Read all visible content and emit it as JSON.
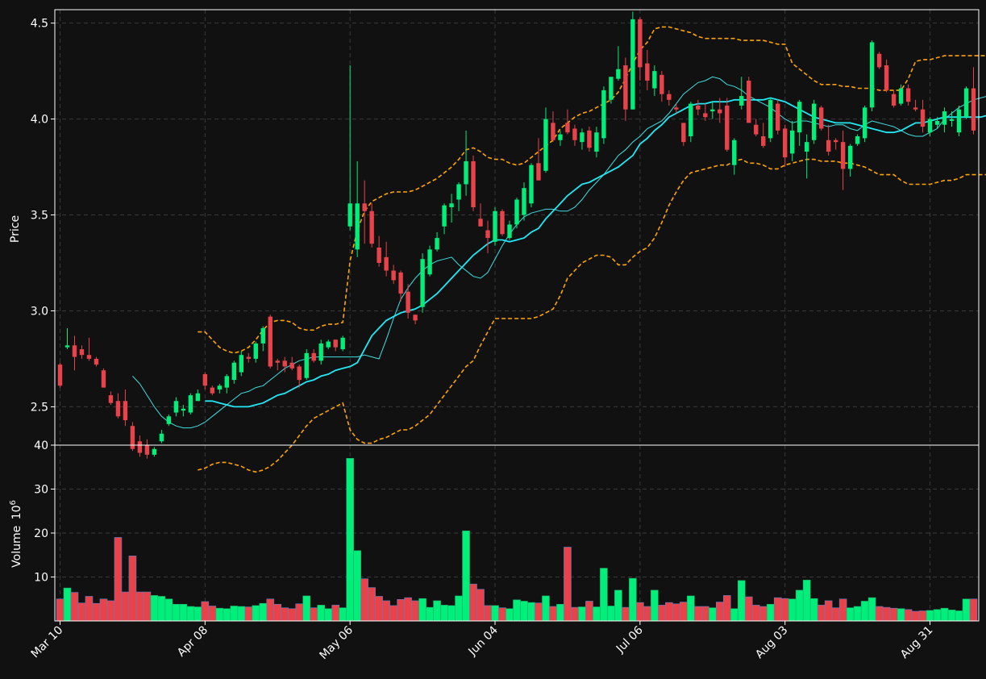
{
  "colors": {
    "background": "#111111",
    "up": "#00ee7a",
    "down": "#e8434b",
    "axis": "#ffffff",
    "grid": "#3a3a3a",
    "sma_slow": "#21e8f5",
    "sma_fast": "#3fe0e0",
    "band": "#ffa500"
  },
  "chart_data": {
    "type": "candlestick",
    "price_panel": {
      "ylabel": "Price",
      "ylim": [
        2.3,
        4.57
      ],
      "yticks": [
        "2.5",
        "3.0",
        "3.5",
        "4.0",
        "4.5"
      ],
      "grid": true
    },
    "volume_panel": {
      "ylabel": "Volume",
      "ylabel_exponent": "10",
      "ylabel_exponent_power": "6",
      "ylim": [
        0,
        40
      ],
      "yticks": [
        "10",
        "20",
        "30",
        "40"
      ],
      "grid": true
    },
    "xtick_labels": [
      "Mar 10",
      "Apr 08",
      "May 06",
      "Jun 04",
      "Jul 06",
      "Aug 03",
      "Aug 31"
    ],
    "xtick_index": [
      0,
      20,
      40,
      60,
      80,
      100,
      120
    ],
    "candles": [
      [
        2.72,
        2.73,
        2.6,
        2.61,
        5.0
      ],
      [
        2.81,
        2.91,
        2.8,
        2.82,
        7.5
      ],
      [
        2.82,
        2.87,
        2.69,
        2.76,
        6.5
      ],
      [
        2.8,
        2.82,
        2.75,
        2.77,
        4.1
      ],
      [
        2.77,
        2.86,
        2.74,
        2.75,
        5.6
      ],
      [
        2.75,
        2.76,
        2.71,
        2.72,
        4.0
      ],
      [
        2.69,
        2.7,
        2.6,
        2.6,
        5.0
      ],
      [
        2.56,
        2.58,
        2.51,
        2.52,
        4.6
      ],
      [
        2.53,
        2.57,
        2.44,
        2.45,
        19.0
      ],
      [
        2.53,
        2.59,
        2.4,
        2.43,
        6.6
      ],
      [
        2.4,
        2.42,
        2.27,
        2.28,
        14.8
      ],
      [
        2.32,
        2.35,
        2.24,
        2.26,
        6.6
      ],
      [
        2.3,
        2.33,
        2.23,
        2.25,
        6.6
      ],
      [
        2.25,
        2.29,
        2.24,
        2.28,
        5.8
      ],
      [
        2.32,
        2.38,
        2.31,
        2.36,
        5.6
      ],
      [
        2.41,
        2.46,
        2.4,
        2.45,
        5.0
      ],
      [
        2.47,
        2.55,
        2.45,
        2.53,
        3.8
      ],
      [
        2.48,
        2.51,
        2.45,
        2.49,
        3.8
      ],
      [
        2.47,
        2.57,
        2.46,
        2.56,
        3.3
      ],
      [
        2.53,
        2.59,
        2.53,
        2.57,
        3.2
      ],
      [
        2.67,
        2.68,
        2.59,
        2.61,
        4.4
      ],
      [
        2.6,
        2.61,
        2.56,
        2.57,
        3.4
      ],
      [
        2.59,
        2.62,
        2.57,
        2.61,
        2.9
      ],
      [
        2.6,
        2.67,
        2.57,
        2.66,
        2.8
      ],
      [
        2.64,
        2.74,
        2.62,
        2.73,
        3.4
      ],
      [
        2.68,
        2.79,
        2.66,
        2.77,
        3.3
      ],
      [
        2.76,
        2.78,
        2.73,
        2.75,
        3.2
      ],
      [
        2.75,
        2.84,
        2.73,
        2.83,
        3.5
      ],
      [
        2.83,
        2.92,
        2.79,
        2.91,
        4.0
      ],
      [
        2.97,
        2.98,
        2.7,
        2.71,
        5.0
      ],
      [
        2.74,
        2.75,
        2.69,
        2.73,
        3.8
      ],
      [
        2.74,
        2.76,
        2.68,
        2.71,
        3.0
      ],
      [
        2.73,
        2.76,
        2.69,
        2.7,
        2.8
      ],
      [
        2.71,
        2.72,
        2.6,
        2.64,
        3.9
      ],
      [
        2.65,
        2.8,
        2.64,
        2.78,
        5.7
      ],
      [
        2.78,
        2.8,
        2.73,
        2.74,
        3.0
      ],
      [
        2.74,
        2.85,
        2.72,
        2.83,
        3.6
      ],
      [
        2.81,
        2.85,
        2.8,
        2.84,
        2.8
      ],
      [
        2.85,
        2.85,
        2.79,
        2.81,
        3.6
      ],
      [
        2.8,
        2.87,
        2.79,
        2.86,
        3.0
      ],
      [
        3.44,
        4.28,
        3.42,
        3.56,
        37.0
      ],
      [
        3.32,
        3.78,
        3.28,
        3.56,
        16.0
      ],
      [
        3.56,
        3.68,
        3.35,
        3.52,
        9.6
      ],
      [
        3.52,
        3.56,
        3.33,
        3.35,
        7.6
      ],
      [
        3.33,
        3.39,
        3.23,
        3.25,
        5.6
      ],
      [
        3.28,
        3.36,
        3.18,
        3.21,
        4.6
      ],
      [
        3.21,
        3.24,
        3.14,
        3.16,
        3.5
      ],
      [
        3.2,
        3.21,
        3.05,
        3.09,
        4.9
      ],
      [
        3.1,
        3.14,
        2.96,
        2.99,
        5.3
      ],
      [
        2.98,
        2.98,
        2.93,
        2.95,
        4.6
      ],
      [
        3.02,
        3.3,
        2.99,
        3.27,
        5.1
      ],
      [
        3.19,
        3.34,
        3.18,
        3.32,
        3.1
      ],
      [
        3.32,
        3.41,
        3.31,
        3.38,
        4.6
      ],
      [
        3.44,
        3.56,
        3.4,
        3.55,
        3.6
      ],
      [
        3.54,
        3.61,
        3.46,
        3.56,
        3.5
      ],
      [
        3.58,
        3.67,
        3.52,
        3.66,
        5.7
      ],
      [
        3.66,
        3.94,
        3.6,
        3.78,
        20.5
      ],
      [
        3.78,
        3.81,
        3.52,
        3.54,
        8.4
      ],
      [
        3.48,
        3.56,
        3.45,
        3.44,
        7.2
      ],
      [
        3.42,
        3.47,
        3.3,
        3.38,
        3.5
      ],
      [
        3.36,
        3.54,
        3.34,
        3.52,
        3.5
      ],
      [
        3.52,
        3.53,
        3.39,
        3.4,
        3.0
      ],
      [
        3.38,
        3.47,
        3.37,
        3.45,
        2.8
      ],
      [
        3.45,
        3.59,
        3.43,
        3.58,
        4.8
      ],
      [
        3.5,
        3.67,
        3.47,
        3.64,
        4.5
      ],
      [
        3.56,
        3.77,
        3.54,
        3.76,
        4.2
      ],
      [
        3.77,
        3.9,
        3.69,
        3.68,
        4.1
      ],
      [
        3.73,
        4.06,
        3.72,
        4.0,
        5.7
      ],
      [
        3.98,
        4.04,
        3.88,
        3.89,
        3.3
      ],
      [
        3.89,
        3.94,
        3.86,
        3.92,
        3.8
      ],
      [
        3.98,
        4.05,
        3.92,
        3.93,
        16.8
      ],
      [
        3.95,
        3.97,
        3.86,
        3.89,
        3.1
      ],
      [
        3.88,
        3.95,
        3.84,
        3.93,
        3.2
      ],
      [
        3.94,
        3.96,
        3.83,
        3.85,
        4.5
      ],
      [
        3.83,
        3.96,
        3.8,
        3.93,
        3.2
      ],
      [
        3.9,
        4.17,
        3.87,
        4.15,
        12.0
      ],
      [
        4.1,
        4.2,
        4.08,
        4.22,
        3.4
      ],
      [
        4.21,
        4.38,
        4.2,
        4.26,
        7.0
      ],
      [
        4.28,
        4.32,
        3.99,
        4.05,
        3.1
      ],
      [
        4.05,
        4.56,
        4.05,
        4.52,
        9.7
      ],
      [
        4.52,
        4.53,
        4.2,
        4.27,
        4.2
      ],
      [
        4.29,
        4.36,
        4.15,
        4.2,
        3.3
      ],
      [
        4.16,
        4.28,
        4.12,
        4.25,
        7.0
      ],
      [
        4.23,
        4.25,
        4.09,
        4.13,
        3.6
      ],
      [
        4.13,
        4.15,
        4.07,
        4.1,
        4.2
      ],
      [
        4.06,
        4.08,
        4.03,
        4.05,
        3.9
      ],
      [
        3.98,
        3.98,
        3.86,
        3.88,
        4.3
      ],
      [
        3.91,
        4.09,
        3.88,
        4.08,
        5.7
      ],
      [
        4.07,
        4.1,
        4.02,
        4.05,
        3.3
      ],
      [
        4.03,
        4.08,
        3.99,
        4.01,
        3.3
      ],
      [
        4.04,
        4.09,
        4.0,
        4.05,
        3.0
      ],
      [
        4.05,
        4.11,
        3.98,
        4.03,
        4.3
      ],
      [
        4.07,
        4.11,
        3.83,
        3.84,
        5.8
      ],
      [
        3.76,
        3.9,
        3.71,
        3.89,
        2.8
      ],
      [
        4.07,
        4.22,
        4.05,
        4.12,
        9.2
      ],
      [
        4.2,
        4.22,
        3.98,
        3.98,
        5.5
      ],
      [
        3.97,
        4.0,
        3.91,
        3.92,
        3.6
      ],
      [
        3.91,
        3.98,
        3.85,
        3.86,
        3.3
      ],
      [
        3.9,
        4.11,
        3.88,
        4.1,
        3.8
      ],
      [
        4.08,
        4.1,
        3.92,
        3.94,
        5.3
      ],
      [
        3.95,
        3.97,
        3.75,
        3.8,
        5.1
      ],
      [
        3.82,
        3.99,
        3.78,
        3.94,
        5.0
      ],
      [
        3.93,
        4.1,
        3.86,
        4.09,
        7.0
      ],
      [
        3.83,
        3.92,
        3.69,
        3.88,
        9.3
      ],
      [
        3.89,
        4.1,
        3.87,
        4.08,
        5.1
      ],
      [
        4.06,
        4.07,
        3.94,
        3.95,
        3.6
      ],
      [
        3.89,
        3.97,
        3.81,
        3.83,
        4.6
      ],
      [
        3.89,
        3.9,
        3.84,
        3.88,
        3.0
      ],
      [
        3.88,
        3.94,
        3.63,
        3.74,
        5.0
      ],
      [
        3.74,
        3.87,
        3.7,
        3.86,
        3.0
      ],
      [
        3.87,
        3.92,
        3.86,
        3.91,
        3.3
      ],
      [
        3.9,
        4.07,
        3.88,
        4.06,
        4.5
      ],
      [
        4.06,
        4.41,
        4.04,
        4.4,
        5.3
      ],
      [
        4.34,
        4.35,
        4.26,
        4.27,
        3.3
      ],
      [
        4.28,
        4.31,
        4.14,
        4.15,
        3.1
      ],
      [
        4.13,
        4.15,
        4.06,
        4.07,
        2.9
      ],
      [
        4.08,
        4.18,
        4.07,
        4.16,
        2.8
      ],
      [
        4.16,
        4.18,
        4.07,
        4.09,
        2.6
      ],
      [
        4.06,
        4.1,
        4.04,
        4.05,
        2.2
      ],
      [
        4.05,
        4.1,
        3.93,
        3.96,
        2.3
      ],
      [
        3.93,
        4.01,
        3.91,
        4.0,
        2.4
      ],
      [
        3.97,
        4.01,
        3.95,
        3.99,
        2.6
      ],
      [
        3.97,
        4.06,
        3.93,
        4.04,
        2.9
      ],
      [
        3.99,
        4.04,
        3.96,
        4.0,
        2.5
      ],
      [
        3.93,
        4.07,
        3.91,
        4.05,
        2.3
      ],
      [
        4.01,
        4.17,
        4.0,
        4.16,
        5.0
      ],
      [
        4.16,
        4.27,
        3.92,
        3.94,
        5.0
      ]
    ],
    "volume_colors": "up/down by candle",
    "overlays": [
      {
        "name": "SMA slow",
        "color": "#21e8f5",
        "start": 20,
        "values": [
          2.53,
          2.53,
          2.52,
          2.51,
          2.5,
          2.5,
          2.5,
          2.51,
          2.52,
          2.54,
          2.56,
          2.57,
          2.59,
          2.61,
          2.63,
          2.64,
          2.66,
          2.67,
          2.69,
          2.7,
          2.71,
          2.73,
          2.8,
          2.87,
          2.91,
          2.95,
          2.97,
          2.99,
          3.0,
          3.01,
          3.03,
          3.06,
          3.09,
          3.13,
          3.17,
          3.21,
          3.25,
          3.29,
          3.32,
          3.35,
          3.37,
          3.37,
          3.36,
          3.37,
          3.38,
          3.41,
          3.43,
          3.48,
          3.52,
          3.56,
          3.6,
          3.63,
          3.66,
          3.67,
          3.69,
          3.71,
          3.73,
          3.75,
          3.78,
          3.81,
          3.87,
          3.9,
          3.94,
          3.97,
          4.01,
          4.03,
          4.05,
          4.07,
          4.08,
          4.08,
          4.09,
          4.09,
          4.09,
          4.1,
          4.1,
          4.1,
          4.1,
          4.1,
          4.11,
          4.1,
          4.09,
          4.07,
          4.05,
          4.03,
          4.01,
          4.0,
          3.99,
          3.98,
          3.98,
          3.98,
          3.97,
          3.96,
          3.95,
          3.94,
          3.93,
          3.93,
          3.94,
          3.96,
          3.98,
          3.98,
          3.99,
          4.0,
          4.01,
          4.01,
          4.01,
          4.01,
          4.01,
          4.01,
          4.02,
          4.02,
          4.02,
          4.03
        ]
      },
      {
        "name": "SMA fast",
        "color": "#3fe0e0",
        "start": 10,
        "values": [
          2.66,
          2.62,
          2.56,
          2.5,
          2.45,
          2.42,
          2.4,
          2.39,
          2.39,
          2.4,
          2.42,
          2.45,
          2.48,
          2.51,
          2.54,
          2.57,
          2.58,
          2.6,
          2.61,
          2.64,
          2.67,
          2.7,
          2.72,
          2.74,
          2.75,
          2.76,
          2.76,
          2.76,
          2.76,
          2.76,
          2.76,
          2.76,
          2.77,
          2.76,
          2.75,
          2.85,
          2.96,
          3.06,
          3.12,
          3.17,
          3.21,
          3.24,
          3.26,
          3.27,
          3.28,
          3.24,
          3.21,
          3.18,
          3.17,
          3.2,
          3.27,
          3.34,
          3.4,
          3.45,
          3.49,
          3.51,
          3.52,
          3.53,
          3.53,
          3.52,
          3.52,
          3.54,
          3.58,
          3.63,
          3.67,
          3.71,
          3.76,
          3.81,
          3.84,
          3.88,
          3.91,
          3.95,
          3.97,
          3.99,
          4.03,
          4.08,
          4.13,
          4.16,
          4.19,
          4.2,
          4.22,
          4.21,
          4.18,
          4.17,
          4.15,
          4.12,
          4.1,
          4.08,
          4.06,
          4.03,
          4.0,
          3.98,
          3.99,
          3.99,
          3.98,
          3.97,
          3.96,
          3.97,
          3.97,
          3.95,
          3.94,
          3.97,
          3.99,
          3.98,
          3.97,
          3.96,
          3.94,
          3.92,
          3.91,
          3.91,
          3.93,
          3.95,
          4.0,
          4.03,
          4.06,
          4.08,
          4.1,
          4.11,
          4.12,
          4.12,
          4.1,
          4.07,
          4.04,
          4.02,
          4.02,
          4.03
        ]
      },
      {
        "name": "Upper band",
        "color": "#ffa500",
        "start": 19,
        "values": [
          2.89,
          2.89,
          2.85,
          2.81,
          2.79,
          2.78,
          2.79,
          2.81,
          2.85,
          2.9,
          2.94,
          2.95,
          2.95,
          2.94,
          2.91,
          2.9,
          2.9,
          2.92,
          2.93,
          2.93,
          2.94,
          3.26,
          3.42,
          3.52,
          3.57,
          3.59,
          3.61,
          3.62,
          3.62,
          3.62,
          3.63,
          3.65,
          3.67,
          3.69,
          3.72,
          3.75,
          3.79,
          3.84,
          3.85,
          3.83,
          3.8,
          3.79,
          3.79,
          3.77,
          3.76,
          3.77,
          3.8,
          3.83,
          3.86,
          3.89,
          3.95,
          3.98,
          4.01,
          4.03,
          4.04,
          4.06,
          4.08,
          4.1,
          4.14,
          4.21,
          4.29,
          4.36,
          4.4,
          4.47,
          4.48,
          4.48,
          4.47,
          4.46,
          4.45,
          4.43,
          4.42,
          4.42,
          4.42,
          4.42,
          4.42,
          4.41,
          4.41,
          4.41,
          4.41,
          4.4,
          4.39,
          4.39,
          4.29,
          4.26,
          4.23,
          4.2,
          4.18,
          4.18,
          4.18,
          4.17,
          4.17,
          4.16,
          4.16,
          4.16,
          4.15,
          4.15,
          4.15,
          4.15,
          4.21,
          4.3,
          4.31,
          4.31,
          4.32,
          4.33,
          4.33,
          4.33,
          4.33,
          4.33,
          4.33,
          4.33,
          4.32,
          4.32,
          4.32,
          4.32,
          4.33,
          4.33
        ]
      },
      {
        "name": "Lower band",
        "color": "#ffa500",
        "start": 19,
        "values": [
          2.17,
          2.18,
          2.2,
          2.21,
          2.21,
          2.2,
          2.19,
          2.17,
          2.16,
          2.17,
          2.19,
          2.22,
          2.26,
          2.3,
          2.35,
          2.4,
          2.44,
          2.46,
          2.48,
          2.5,
          2.52,
          2.38,
          2.33,
          2.31,
          2.31,
          2.33,
          2.34,
          2.36,
          2.38,
          2.38,
          2.4,
          2.43,
          2.46,
          2.51,
          2.56,
          2.61,
          2.66,
          2.71,
          2.74,
          2.82,
          2.89,
          2.96,
          2.96,
          2.96,
          2.96,
          2.96,
          2.96,
          2.97,
          2.99,
          3.01,
          3.08,
          3.17,
          3.21,
          3.25,
          3.27,
          3.29,
          3.29,
          3.28,
          3.24,
          3.24,
          3.28,
          3.31,
          3.33,
          3.38,
          3.46,
          3.55,
          3.62,
          3.68,
          3.72,
          3.73,
          3.74,
          3.75,
          3.76,
          3.76,
          3.78,
          3.79,
          3.77,
          3.77,
          3.76,
          3.74,
          3.74,
          3.76,
          3.77,
          3.78,
          3.79,
          3.79,
          3.78,
          3.78,
          3.78,
          3.77,
          3.77,
          3.76,
          3.75,
          3.73,
          3.71,
          3.71,
          3.71,
          3.68,
          3.66,
          3.66,
          3.66,
          3.66,
          3.67,
          3.68,
          3.68,
          3.69,
          3.71,
          3.71,
          3.71,
          3.71,
          3.72,
          3.72,
          3.73,
          3.74
        ]
      }
    ]
  }
}
